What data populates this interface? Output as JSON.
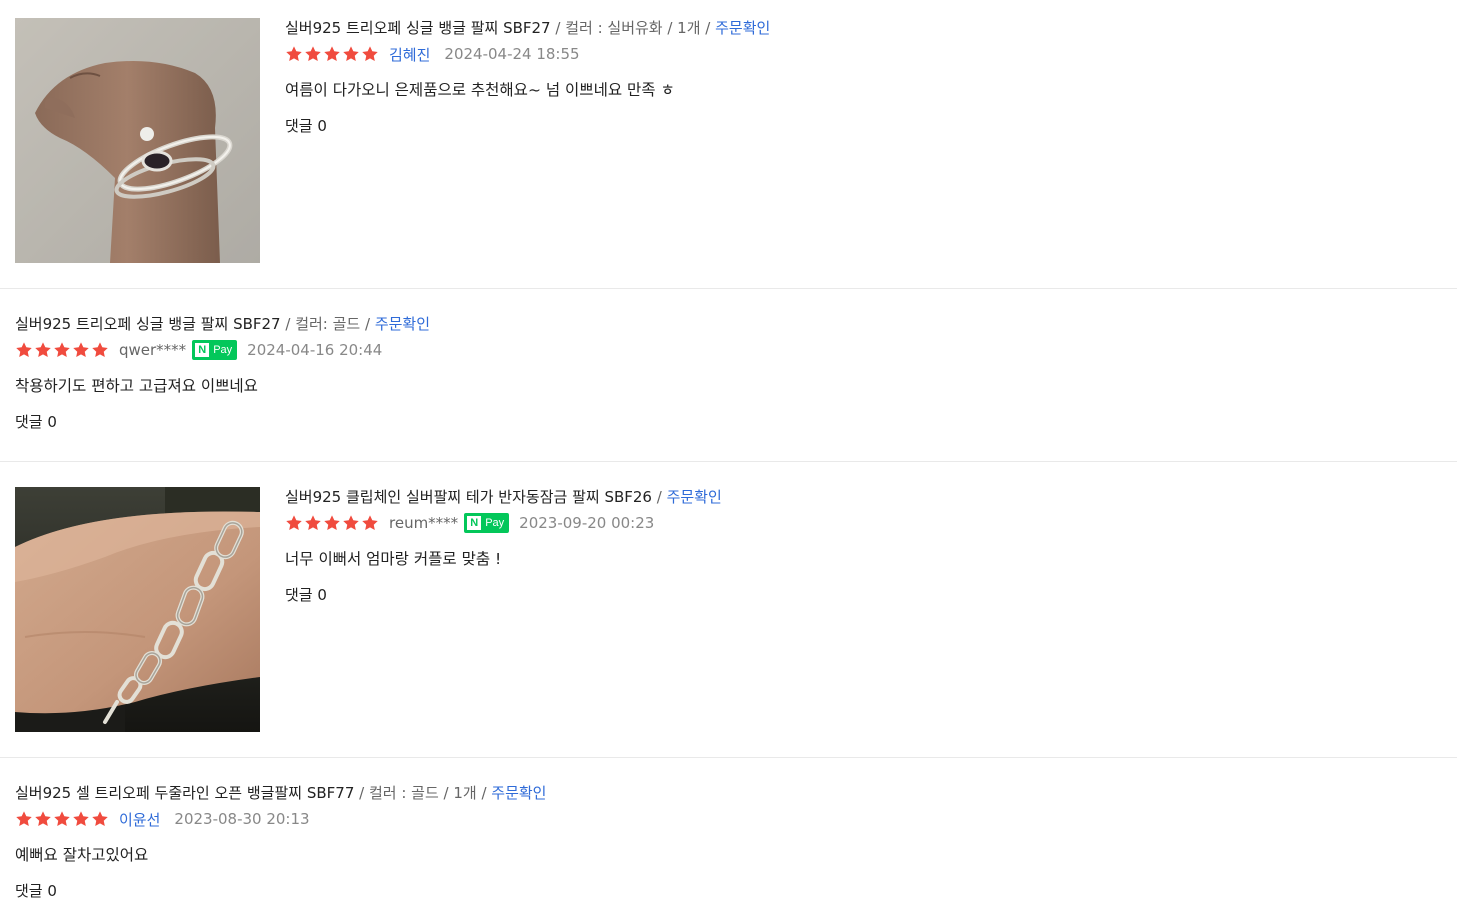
{
  "reviews": [
    {
      "product": "실버925 트리오페 싱글 뱅글 팔찌 SBF27",
      "option": " / 컬러 : 실버유화 / 1개 / ",
      "order_link": "주문확인",
      "rating": 5,
      "author": "김혜진",
      "npay": false,
      "date": "2024-04-24 18:55",
      "text": "여름이 다가오니 은제품으로 추천해요~ 넘 이쁘네요 만족 ㅎ",
      "comments": "댓글 0",
      "photo": "bangle-on-wrist-photo"
    },
    {
      "product": "실버925 트리오페 싱글 뱅글 팔찌 SBF27",
      "option": " / 컬러: 골드 / ",
      "order_link": "주문확인",
      "rating": 5,
      "author": "qwer****",
      "npay": true,
      "date": "2024-04-16 20:44",
      "text": "착용하기도 편하고 고급져요 이쁘네요",
      "comments": "댓글 0"
    },
    {
      "product": "실버925 클립체인 실버팔찌 테가 반자동잠금 팔찌 SBF26",
      "option": " / ",
      "order_link": "주문확인",
      "rating": 5,
      "author": "reum****",
      "npay": true,
      "date": "2023-09-20 00:23",
      "text": "너무 이뻐서 엄마랑 커플로 맞춤 !",
      "comments": "댓글 0",
      "photo": "chain-bracelet-on-wrist-photo"
    },
    {
      "product": "실버925 셀 트리오페 두줄라인 오픈 뱅글팔찌 SBF77",
      "option": " / 컬러 : 골드 / 1개 / ",
      "order_link": "주문확인",
      "rating": 5,
      "author": "이윤선",
      "npay": false,
      "date": "2023-08-30 20:13",
      "text": "예뻐요 잘차고있어요",
      "comments": "댓글 0"
    }
  ],
  "npay_badge": {
    "n": "N",
    "pay": "Pay"
  },
  "colors": {
    "star": "#f04b3e",
    "link": "#2f6bd8",
    "npay": "#03c75a",
    "muted": "#888888"
  }
}
